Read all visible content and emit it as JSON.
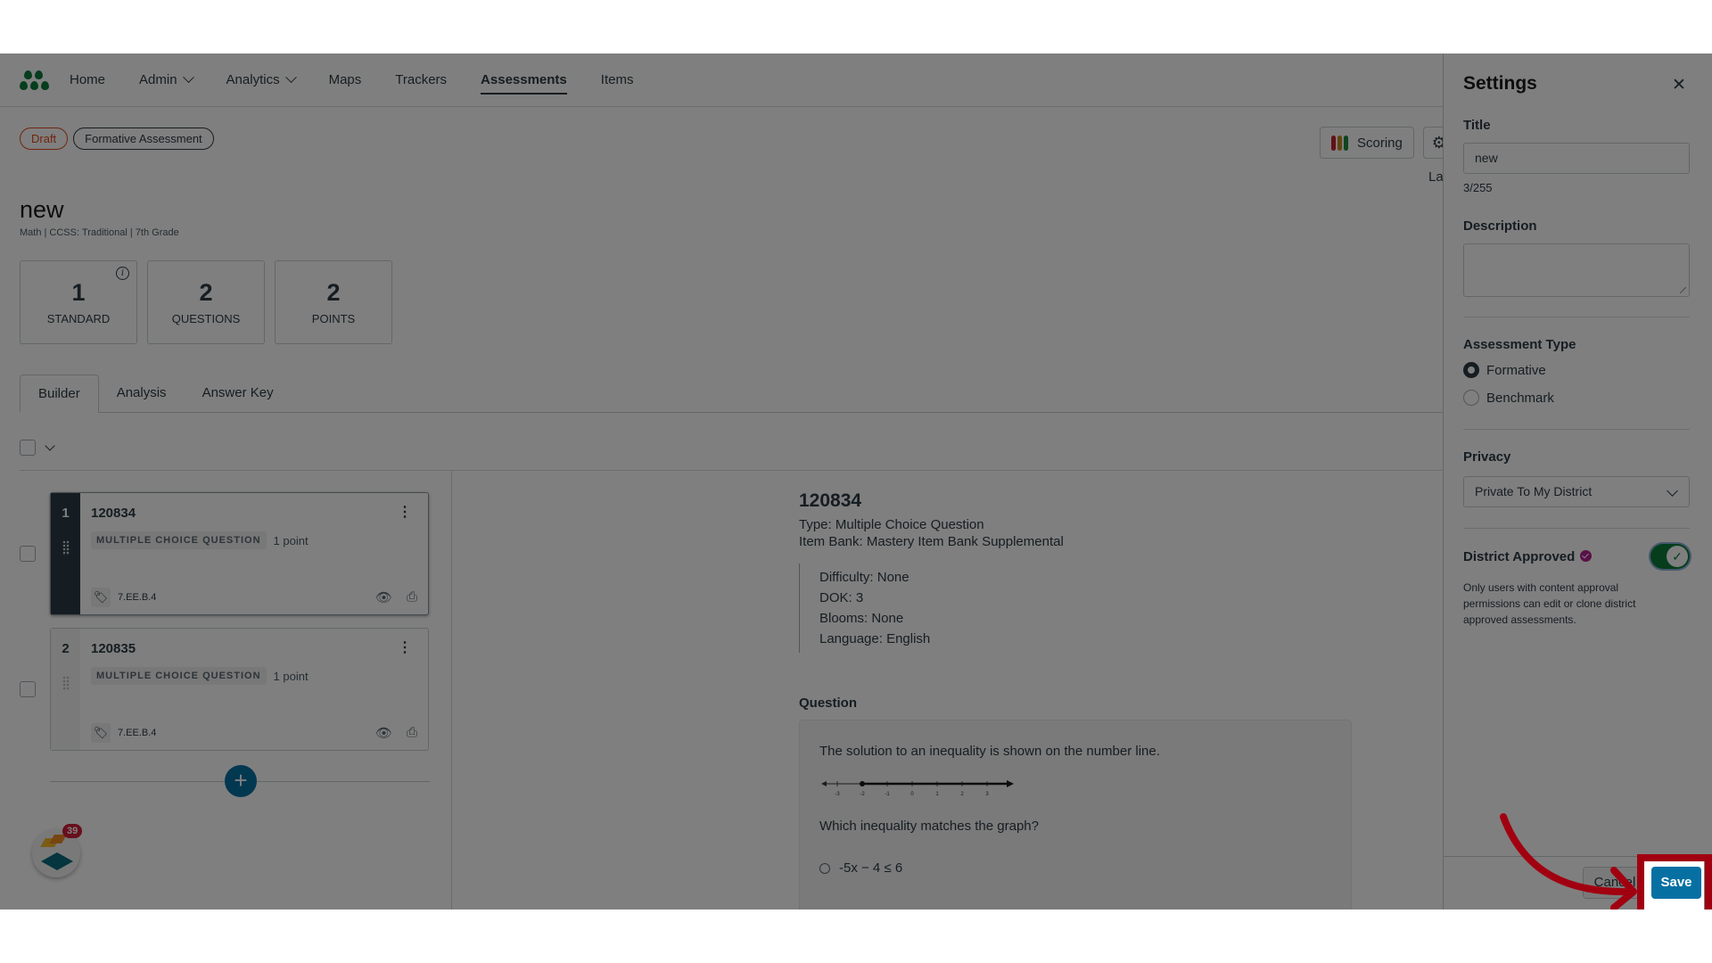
{
  "nav": {
    "items": [
      {
        "label": "Home",
        "dropdown": false,
        "active": false
      },
      {
        "label": "Admin",
        "dropdown": true,
        "active": false
      },
      {
        "label": "Analytics",
        "dropdown": true,
        "active": false
      },
      {
        "label": "Maps",
        "dropdown": false,
        "active": false
      },
      {
        "label": "Trackers",
        "dropdown": false,
        "active": false
      },
      {
        "label": "Assessments",
        "dropdown": false,
        "active": true
      },
      {
        "label": "Items",
        "dropdown": false,
        "active": false
      }
    ]
  },
  "badges": {
    "status": "Draft",
    "type": "Formative Assessment"
  },
  "actions": {
    "scoring_label": "Scoring",
    "truncated_label": "La"
  },
  "colors": {
    "accent": "#0770a3",
    "draft": "#e0491c",
    "toggle_on": "#0b7a3b",
    "verified": "#b3238f",
    "highlight": "#a10010",
    "scoring_bars": [
      "#c7202e",
      "#c28b1e",
      "#1e8a3e"
    ]
  },
  "assessment": {
    "title": "new",
    "subtitle": "Math  |  CCSS: Traditional  |  7th Grade",
    "stats": [
      {
        "value": "1",
        "label": "STANDARD",
        "info": true
      },
      {
        "value": "2",
        "label": "QUESTIONS",
        "info": false
      },
      {
        "value": "2",
        "label": "POINTS",
        "info": false
      }
    ]
  },
  "tabs": [
    {
      "label": "Builder",
      "active": true
    },
    {
      "label": "Analysis",
      "active": false
    },
    {
      "label": "Answer Key",
      "active": false
    }
  ],
  "questions": [
    {
      "number": "1",
      "id": "120834",
      "type": "MULTIPLE CHOICE QUESTION",
      "points": "1 point",
      "standard": "7.EE.B.4",
      "selected": true
    },
    {
      "number": "2",
      "id": "120835",
      "type": "MULTIPLE CHOICE QUESTION",
      "points": "1 point",
      "standard": "7.EE.B.4",
      "selected": false
    }
  ],
  "widget": {
    "notification_count": "39"
  },
  "preview": {
    "id": "120834",
    "type_line": "Type: Multiple Choice Question",
    "bank_line": "Item Bank: Mastery Item Bank Supplemental",
    "meta": [
      "Difficulty: None",
      "DOK: 3",
      "Blooms: None",
      "Language: English"
    ],
    "question_label": "Question",
    "question_text": "The solution to an inequality is shown on the number line.",
    "number_line": {
      "ticks": [
        "-3",
        "-2",
        "-1",
        "0",
        "1",
        "2",
        "3"
      ],
      "closed_point": -2,
      "direction": "right"
    },
    "prompt": "Which inequality matches the graph?",
    "options": [
      "-5x − 4 ≤ 6"
    ]
  },
  "settings": {
    "heading": "Settings",
    "title_label": "Title",
    "title_value": "new",
    "title_count": "3/255",
    "description_label": "Description",
    "description_value": "",
    "type_label": "Assessment Type",
    "type_options": [
      {
        "label": "Formative",
        "checked": true
      },
      {
        "label": "Benchmark",
        "checked": false
      }
    ],
    "privacy_label": "Privacy",
    "privacy_value": "Private To My District",
    "approved_label": "District Approved",
    "approved_on": true,
    "approved_help": "Only users with content approval permissions can edit or clone district approved assessments.",
    "cancel_label": "Cancel",
    "save_label": "Save"
  }
}
